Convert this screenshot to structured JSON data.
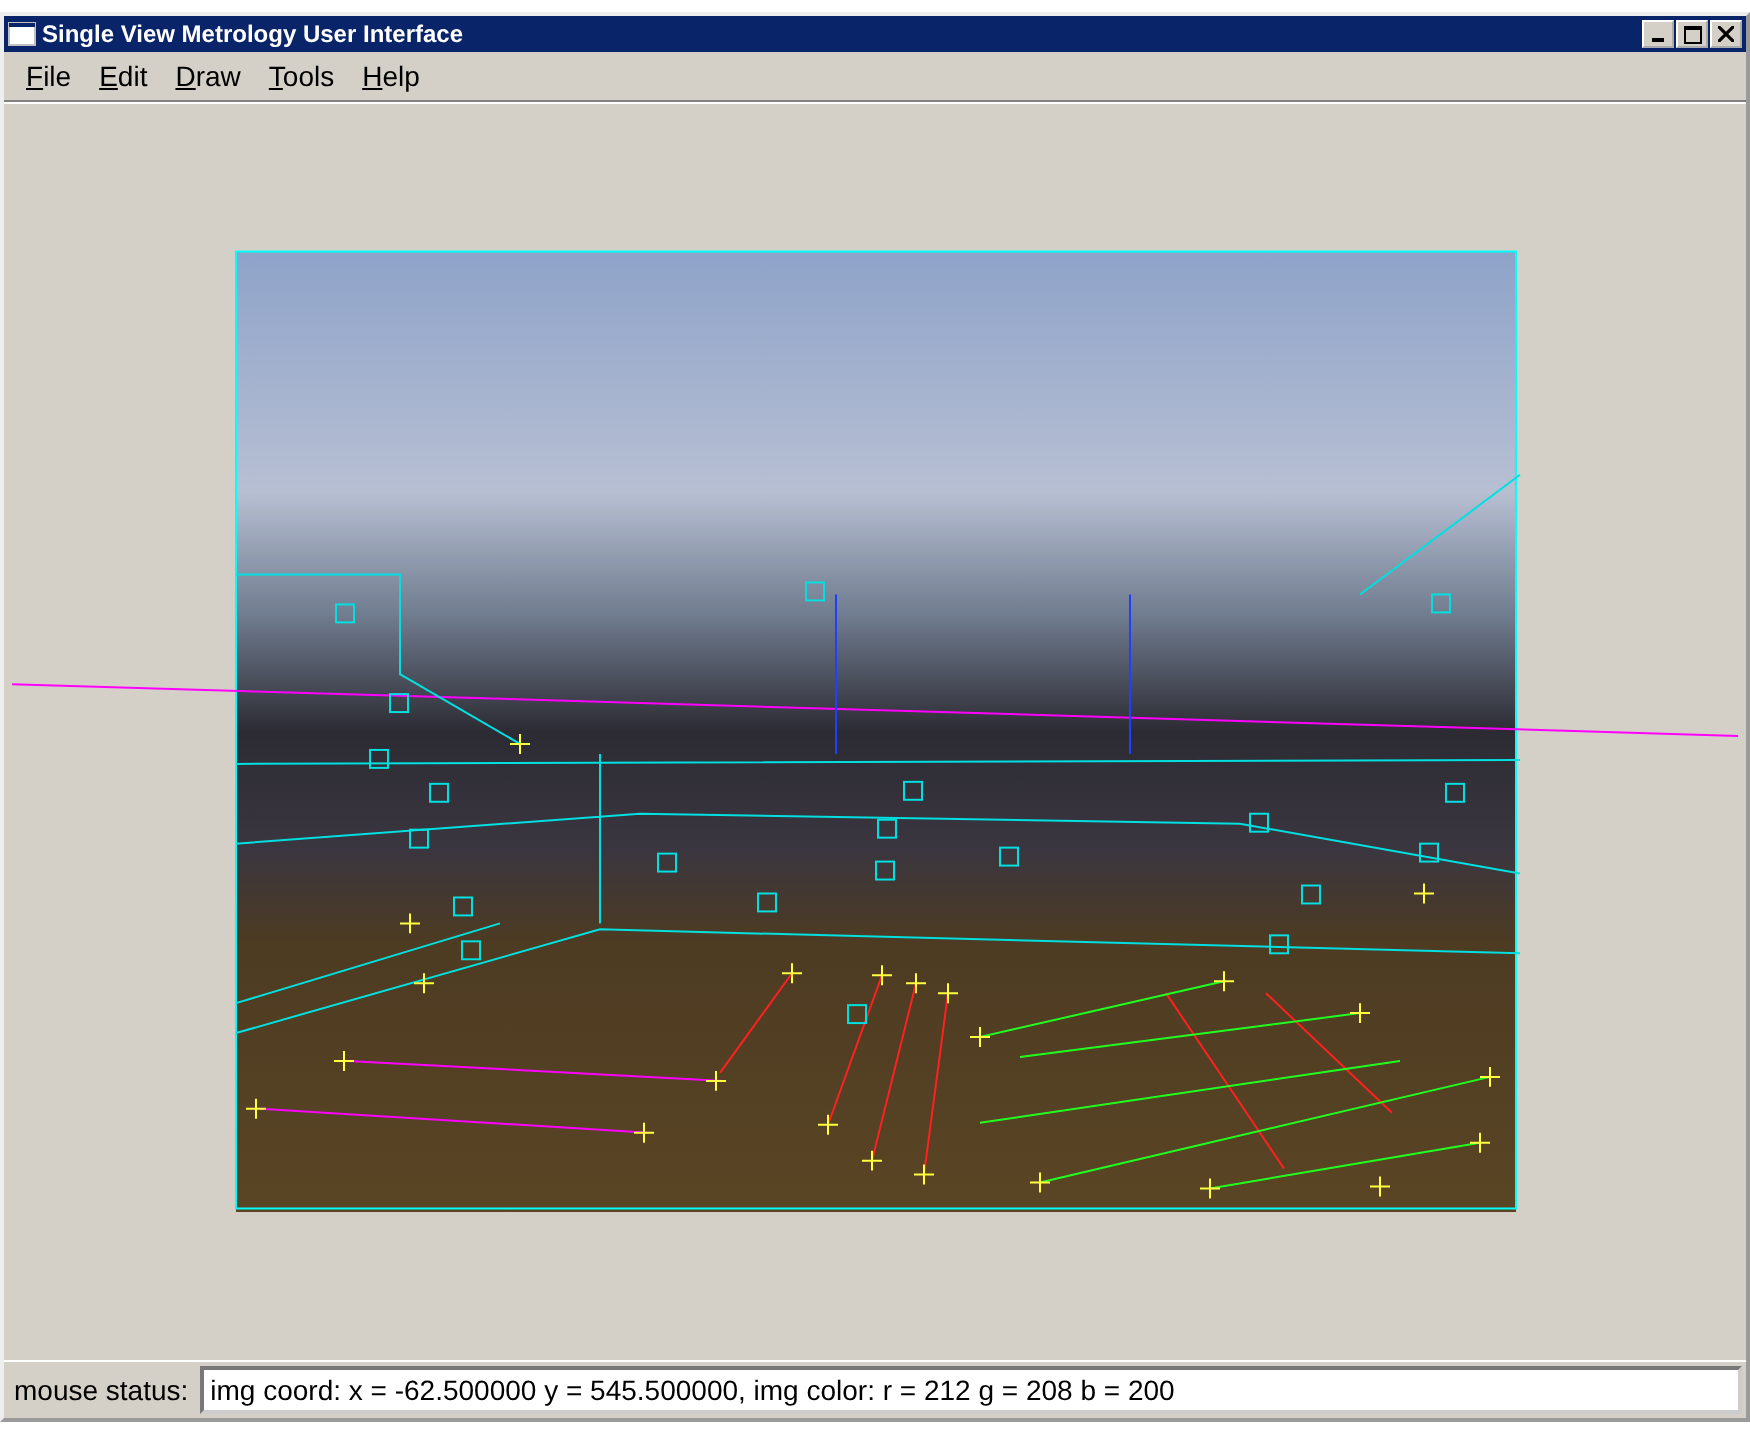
{
  "window": {
    "title": "Single View Metrology User Interface"
  },
  "menu": [
    "File",
    "Edit",
    "Draw",
    "Tools",
    "Help"
  ],
  "status_bar": {
    "label": "mouse status:",
    "value": "img coord: x = -62.500000 y = 545.500000, img color: r = 212 g = 208 b = 200"
  }
}
